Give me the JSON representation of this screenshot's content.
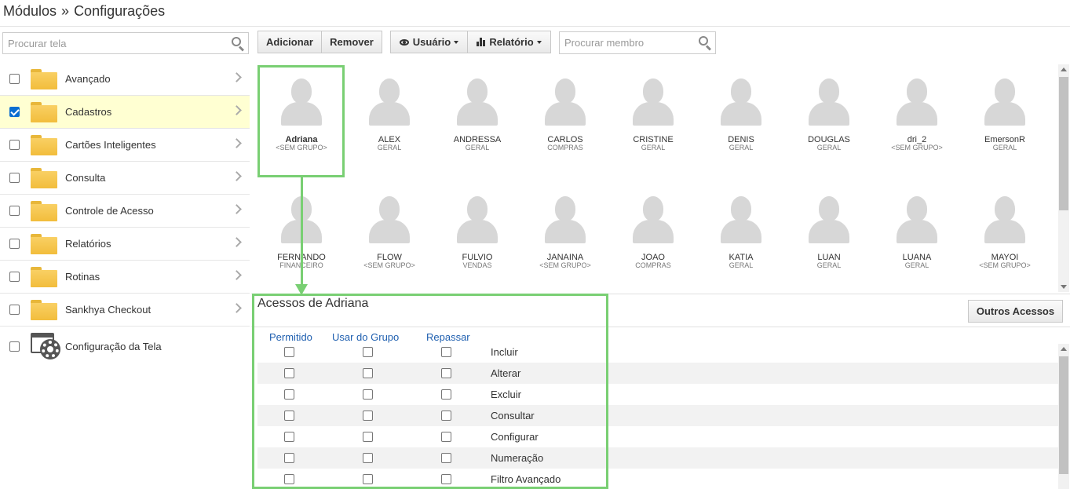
{
  "breadcrumb": {
    "root": "Módulos",
    "separator": "»",
    "current": "Configurações"
  },
  "left_search": {
    "placeholder": "Procurar tela"
  },
  "modules": [
    {
      "label": "Avançado",
      "checked": false
    },
    {
      "label": "Cadastros",
      "checked": true
    },
    {
      "label": "Cartões Inteligentes",
      "checked": false
    },
    {
      "label": "Consulta",
      "checked": false
    },
    {
      "label": "Controle de Acesso",
      "checked": false
    },
    {
      "label": "Relatórios",
      "checked": false
    },
    {
      "label": "Rotinas",
      "checked": false
    },
    {
      "label": "Sankhya Checkout",
      "checked": false
    }
  ],
  "config_item": {
    "label": "Configuração da Tela",
    "checked": false
  },
  "toolbar": {
    "add_label": "Adicionar",
    "remove_label": "Remover",
    "user_label": "Usuário",
    "report_label": "Relatório",
    "member_search_placeholder": "Procurar membro"
  },
  "members": [
    {
      "name": "Adriana",
      "group": "<SEM GRUPO>"
    },
    {
      "name": "ALEX",
      "group": "GERAL"
    },
    {
      "name": "ANDRESSA",
      "group": "GERAL"
    },
    {
      "name": "CARLOS",
      "group": "COMPRAS"
    },
    {
      "name": "CRISTINE",
      "group": "GERAL"
    },
    {
      "name": "DENIS",
      "group": "GERAL"
    },
    {
      "name": "DOUGLAS",
      "group": "GERAL"
    },
    {
      "name": "dri_2",
      "group": "<SEM GRUPO>"
    },
    {
      "name": "EmersonR",
      "group": "GERAL"
    },
    {
      "name": "FERNANDO",
      "group": "FINANCEIRO"
    },
    {
      "name": "FLOW",
      "group": "<SEM GRUPO>"
    },
    {
      "name": "FULVIO",
      "group": "VENDAS"
    },
    {
      "name": "JANAINA",
      "group": "<SEM GRUPO>"
    },
    {
      "name": "JOAO",
      "group": "COMPRAS"
    },
    {
      "name": "KATIA",
      "group": "GERAL"
    },
    {
      "name": "LUAN",
      "group": "GERAL"
    },
    {
      "name": "LUANA",
      "group": "GERAL"
    },
    {
      "name": "MAYOI",
      "group": "<SEM GRUPO>"
    }
  ],
  "access": {
    "title": "Acessos de Adriana",
    "other_button": "Outros Acessos",
    "columns": [
      "Permitido",
      "Usar do Grupo",
      "Repassar"
    ],
    "permissions": [
      "Incluir",
      "Alterar",
      "Excluir",
      "Consultar",
      "Configurar",
      "Numeração",
      "Filtro Avançado"
    ]
  },
  "colors": {
    "highlight_annotation": "#79cf73",
    "selected_row": "#ffffd2",
    "column_header": "#2060b0"
  }
}
